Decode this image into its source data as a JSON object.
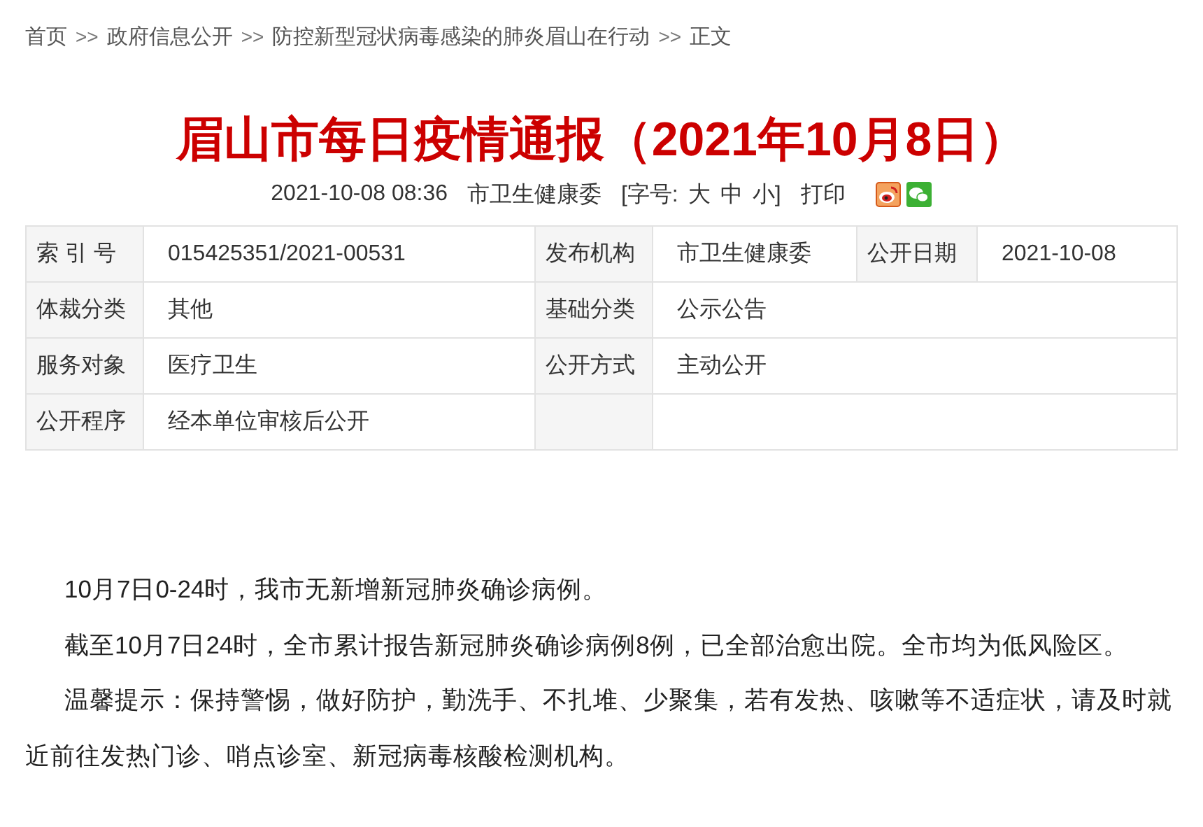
{
  "breadcrumb": {
    "items": [
      "首页",
      "政府信息公开",
      "防控新型冠状病毒感染的肺炎眉山在行动",
      "正文"
    ],
    "separator": ">>"
  },
  "article": {
    "title": "眉山市每日疫情通报（2021年10月8日）",
    "meta": {
      "datetime": "2021-10-08 08:36",
      "source": "市卫生健康委",
      "font_size_label": "[字号:",
      "font_sizes": [
        "大",
        "中",
        "小]"
      ],
      "print": "打印"
    },
    "info_table": [
      {
        "cells": [
          {
            "kind": "label",
            "text": "索 引 号"
          },
          {
            "kind": "value",
            "text": "015425351/2021-00531"
          },
          {
            "kind": "label",
            "text": "发布机构"
          },
          {
            "kind": "value",
            "text": "市卫生健康委"
          },
          {
            "kind": "label",
            "text": "公开日期"
          },
          {
            "kind": "value",
            "text": "2021-10-08"
          }
        ]
      },
      {
        "cells": [
          {
            "kind": "label",
            "text": "体裁分类"
          },
          {
            "kind": "value",
            "text": "其他"
          },
          {
            "kind": "label",
            "text": "基础分类"
          },
          {
            "kind": "value",
            "text": "公示公告"
          }
        ]
      },
      {
        "cells": [
          {
            "kind": "label",
            "text": "服务对象"
          },
          {
            "kind": "value",
            "text": "医疗卫生"
          },
          {
            "kind": "label",
            "text": "公开方式"
          },
          {
            "kind": "value",
            "text": "主动公开"
          }
        ]
      },
      {
        "cells": [
          {
            "kind": "label",
            "text": "公开程序"
          },
          {
            "kind": "value",
            "text": "经本单位审核后公开"
          },
          {
            "kind": "label"
          },
          {
            "kind": "value"
          }
        ]
      }
    ],
    "paragraphs": [
      "10月7日0-24时，我市无新增新冠肺炎确诊病例。",
      "截至10月7日24时，全市累计报告新冠肺炎确诊病例8例，已全部治愈出院。全市均为低风险区。",
      "温馨提示：保持警惕，做好防护，勤洗手、不扎堆、少聚集，若有发热、咳嗽等不适症状，请及时就近前往发热门诊、哨点诊室、新冠病毒核酸检测机构。"
    ]
  }
}
